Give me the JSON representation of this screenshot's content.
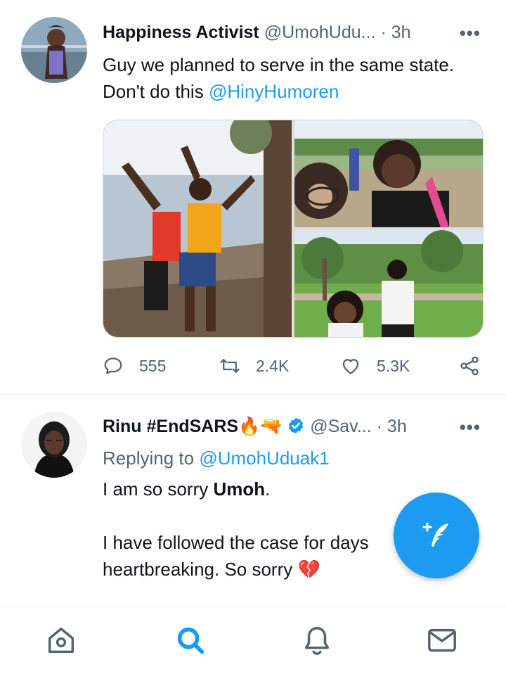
{
  "tweets": [
    {
      "name": "Happiness Activist",
      "handle": "@UmohUdu...",
      "time": "· 3h",
      "more": "•••",
      "text_line1": "Guy we planned to serve in the same state.",
      "text_line2_prefix": "Don't do this ",
      "text_line2_mention": "@HinyHumoren",
      "replies": "555",
      "retweets": "2.4K",
      "likes": "5.3K"
    },
    {
      "name": "Rinu #EndSARS",
      "name_emoji": "🔥🔫",
      "handle": "@Sav...",
      "time": "· 3h",
      "more": "•••",
      "replying_prefix": "Replying to ",
      "replying_handle": "@UmohUduak1",
      "text_line1_prefix": "I am so sorry ",
      "text_line1_bold": "Umoh",
      "text_line1_suffix": ".",
      "text_line2": "I have followed the case for days",
      "text_line3": "heartbreaking. So sorry",
      "text_line3_emoji": "💔"
    }
  ],
  "icons": {
    "reply": "reply-icon",
    "retweet": "retweet-icon",
    "like": "heart-icon",
    "share": "share-icon",
    "compose": "compose-tweet-icon",
    "home": "home-icon",
    "search": "search-icon",
    "notifications": "bell-icon",
    "messages": "mail-icon"
  },
  "colors": {
    "accent": "#1d9bf0",
    "text": "#0f1419",
    "muted": "#536471"
  }
}
